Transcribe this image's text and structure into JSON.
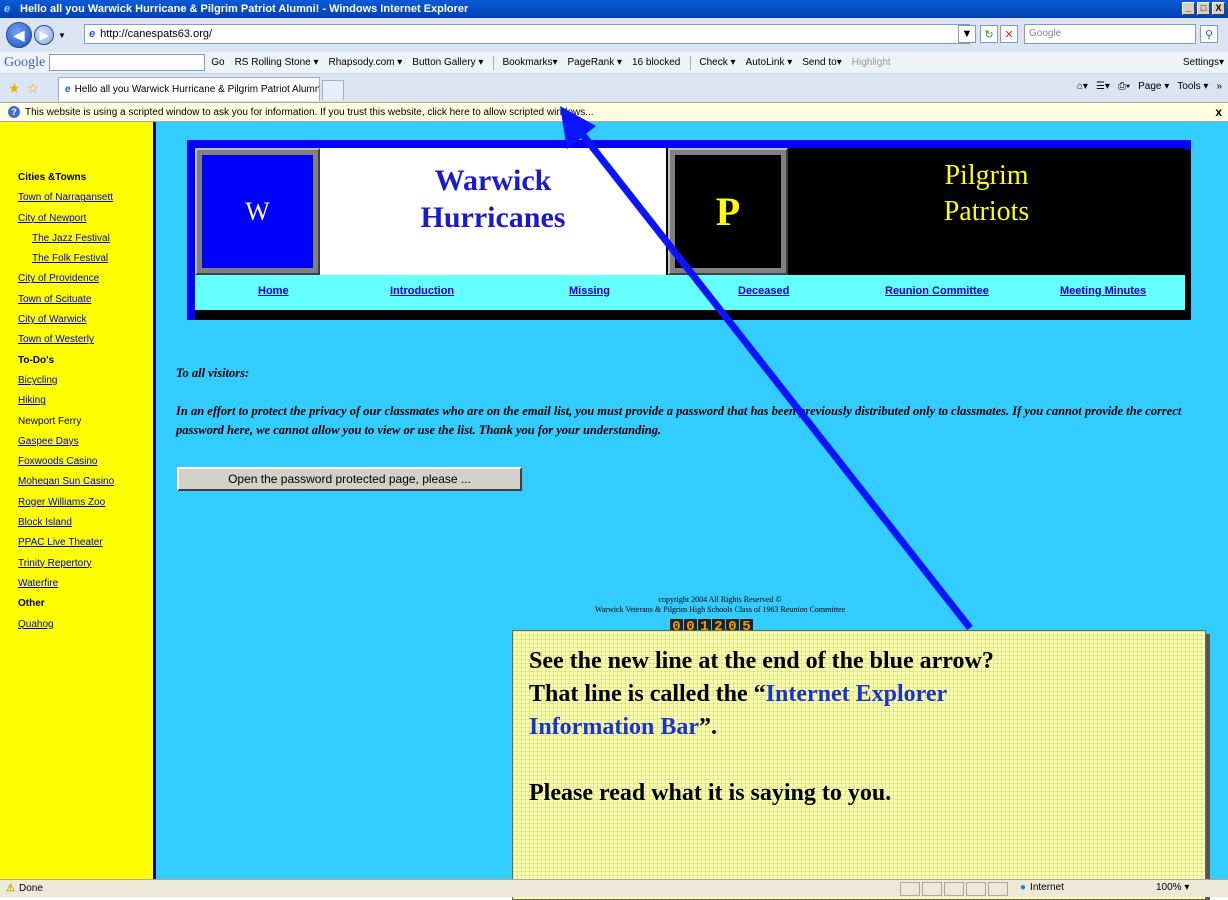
{
  "window": {
    "title": "Hello all you Warwick Hurricane & Pilgrim Patriot Alumni! - Windows Internet Explorer",
    "buttons": [
      "_",
      "□",
      "X"
    ]
  },
  "address": {
    "url": "http://canespats63.org/",
    "search_placeholder": "Google"
  },
  "google_toolbar": {
    "logo": "Google",
    "items": [
      "Go",
      "RS Rolling Stone ▾",
      "Rhapsody.com ▾",
      "Button Gallery ▾",
      "Bookmarks▾",
      "PageRank ▾",
      "16 blocked",
      "Check ▾",
      "AutoLink ▾",
      "Send to▾",
      "Highlight"
    ],
    "settings": "Settings▾"
  },
  "tabs": {
    "active": "Hello all you Warwick Hurricane & Pilgrim Patriot Alumni!",
    "commands": [
      "Page ▾",
      "Tools ▾"
    ]
  },
  "infobar": {
    "message": "This website is using a scripted window to ask you for information. If you trust this website, click here to allow scripted windows...",
    "close": "x"
  },
  "sidebar": {
    "items": [
      {
        "label": "Cities &Towns",
        "type": "heading"
      },
      {
        "label": "Town of Narragansett",
        "type": "link"
      },
      {
        "label": "City of Newport",
        "type": "link"
      },
      {
        "label": "The Jazz Festival",
        "type": "sublink"
      },
      {
        "label": "The Folk Festival",
        "type": "sublink"
      },
      {
        "label": "City of Providence",
        "type": "link"
      },
      {
        "label": "Town of Scituate",
        "type": "link"
      },
      {
        "label": "City of Warwick",
        "type": "link"
      },
      {
        "label": "Town of Westerly",
        "type": "link"
      },
      {
        "label": "To-Do's",
        "type": "heading"
      },
      {
        "label": "Bicycling",
        "type": "link"
      },
      {
        "label": "Hiking",
        "type": "link"
      },
      {
        "label": "Newport Ferry",
        "type": "plain"
      },
      {
        "label": "Gaspee Days",
        "type": "link"
      },
      {
        "label": "Foxwoods Casino",
        "type": "link"
      },
      {
        "label": "Mohegan Sun Casino",
        "type": "link"
      },
      {
        "label": "Roger Williams Zoo",
        "type": "link"
      },
      {
        "label": "Block Island",
        "type": "link"
      },
      {
        "label": "PPAC Live Theater",
        "type": "link"
      },
      {
        "label": "Trinity Repertory",
        "type": "link"
      },
      {
        "label": "Waterfire",
        "type": "link"
      },
      {
        "label": "Other",
        "type": "heading"
      },
      {
        "label": "Quahog",
        "type": "link"
      }
    ]
  },
  "banner": {
    "w_letter": "W",
    "w_title_1": "Warwick",
    "w_title_2": "Hurricanes",
    "p_letter": "P",
    "p_title_1": "Pilgrim",
    "p_title_2": "Patriots",
    "nav": [
      "Home",
      "Introduction",
      "Missing",
      "Deceased",
      "Reunion Committee",
      "Meeting Minutes"
    ]
  },
  "main": {
    "visitors": "To all visitors:",
    "privacy": "In an effort to protect the privacy of our classmates who are on the email list, you must provide a password that has been previously distributed only to classmates.  If you cannot provide the correct password here, we cannot allow you to view or use the list.  Thank you for your understanding.",
    "button": "Open the password protected page, please ...",
    "copyright_1": "copyright 2004 All Rights Reserved ©",
    "copyright_2": "Warwick Veterans & Pilgrim High Schools Class of 1963 Reunion Committee",
    "counter": [
      "0",
      "0",
      "1",
      "2",
      "0",
      "5"
    ]
  },
  "callout": {
    "line1": "See the new line at the end of the blue arrow?",
    "line2a": "That line is called the “",
    "line2b": "Internet Explorer",
    "line3a": "Information Bar",
    "line3b": "”.",
    "line4": "Please read what it is saying to you."
  },
  "status": {
    "text": "Done",
    "zone": "Internet",
    "zoom": "100%  ▾"
  },
  "colors": {
    "page_bg": "#33ccff",
    "sidebar_bg": "#ffff00",
    "arrow": "#0a14ff",
    "infobar_bg": "#ffffe1"
  }
}
